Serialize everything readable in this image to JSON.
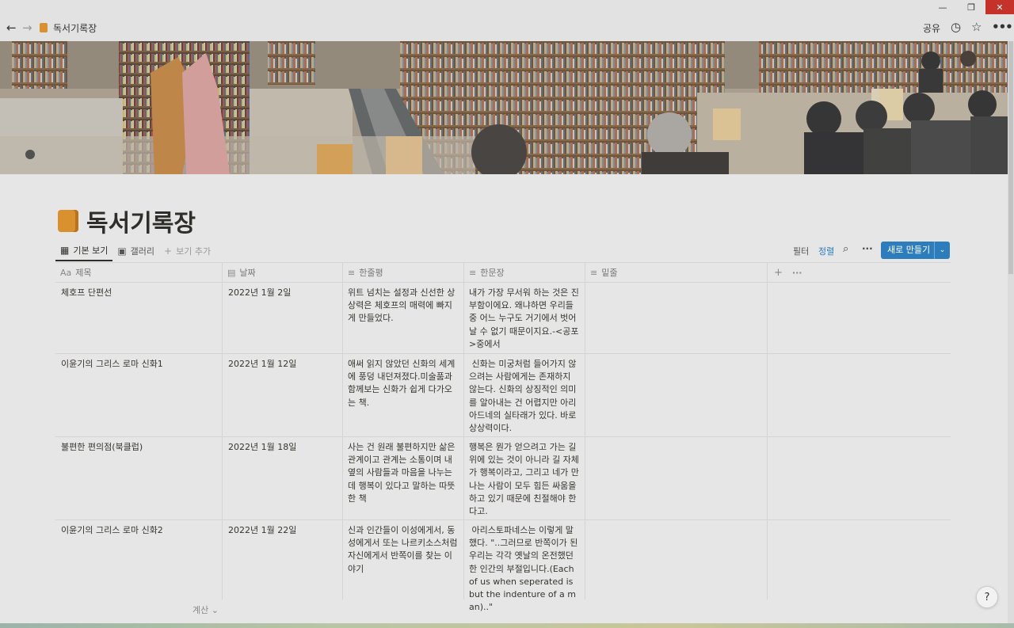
{
  "window": {
    "min_glyph": "—",
    "max_glyph": "❐",
    "close_glyph": "✕"
  },
  "topbar": {
    "back_glyph": "←",
    "forward_glyph": "→",
    "breadcrumb": "독서기록장",
    "share": "공유",
    "clock_glyph": "◷",
    "star_glyph": "☆",
    "more_glyph": "•••"
  },
  "page": {
    "title": "독서기록장",
    "icon": "book-icon"
  },
  "views": {
    "tabs": [
      {
        "icon": "▦",
        "label": "기본 보기"
      },
      {
        "icon": "▣",
        "label": "갤러리"
      }
    ],
    "add": {
      "icon": "+",
      "label": "보기 추가"
    }
  },
  "toolbar": {
    "filter": "필터",
    "sort": "정렬",
    "search_glyph": "⌕",
    "more_glyph": "···",
    "new_label": "새로 만들기",
    "new_chevron": "⌄"
  },
  "table": {
    "columns": [
      {
        "icon": "Aa",
        "label": "제목"
      },
      {
        "icon": "▤",
        "label": "날짜"
      },
      {
        "icon": "≡",
        "label": "한줄평"
      },
      {
        "icon": "≡",
        "label": "한문장"
      },
      {
        "icon": "≡",
        "label": "밑줄"
      }
    ],
    "add_glyph": "+",
    "more_glyph": "···",
    "rows": [
      {
        "title": "체호프 단편선",
        "date": "2022년 1월 2일",
        "review": "위트 넘치는 설정과 신선한 상상력은 체호프의 매력에 빠지게 만들었다.",
        "sentence": "내가 가장 무서워 하는 것은 진부함이에요. 왜냐하면 우리들 중 어느 누구도 거기에서 벗어날 수 없기 때문이지요.-<공포>중에서",
        "underline": ""
      },
      {
        "title": "이윤기의 그리스 로마 신화1",
        "date": "2022년 1월 12일",
        "review": "애써 읽지 않았던 신화의 세계에 풍덩 내던져졌다.미술품과 함께보는 신화가 쉽게 다가오는 책.",
        "sentence": " 신화는 미궁처럼 들어가지 않으려는 사람에게는 존재하지 않는다. 신화의 상징적인 의미를 알아내는 건 어렵지만 아리아드네의 실타래가 있다. 바로 상상력이다.",
        "underline": ""
      },
      {
        "title": "불편한 편의점(북클럽)",
        "date": "2022년 1월 18일",
        "review": "사는 건 원래 불편하지만 삶은 관계이고 관계는 소통이며 내 옆의 사람들과 마음을 나누는 데 행복이 있다고 말하는 따뜻한 책",
        "sentence": "행복은 뭔가 얻으려고 가는 길 위에 있는 것이 아니라 길 자체가 행복이라고, 그리고 네가 만나는 사람이 모두 힘든 싸움을 하고 있기 때문에 친절해야 한다고.",
        "underline": ""
      },
      {
        "title": "이윤기의 그리스 로마 신화2",
        "date": "2022년 1월 22일",
        "review": "신과 인간들이 이성에게서, 동성에게서 또는 나르키소스처럼 자신에게서 반쪽이를 찾는 이야기",
        "sentence": " 아리스토파네스는 이렇게 말했다. \"..그러므로 반쪽이가 된 우리는 각각 옛날의 온전했던 한 인간의 부절입니다.(Each of us when seperated is but the indenture of a man)..\"",
        "underline": ""
      }
    ]
  },
  "footer": {
    "calc": "계산 ⌄",
    "help": "?"
  }
}
